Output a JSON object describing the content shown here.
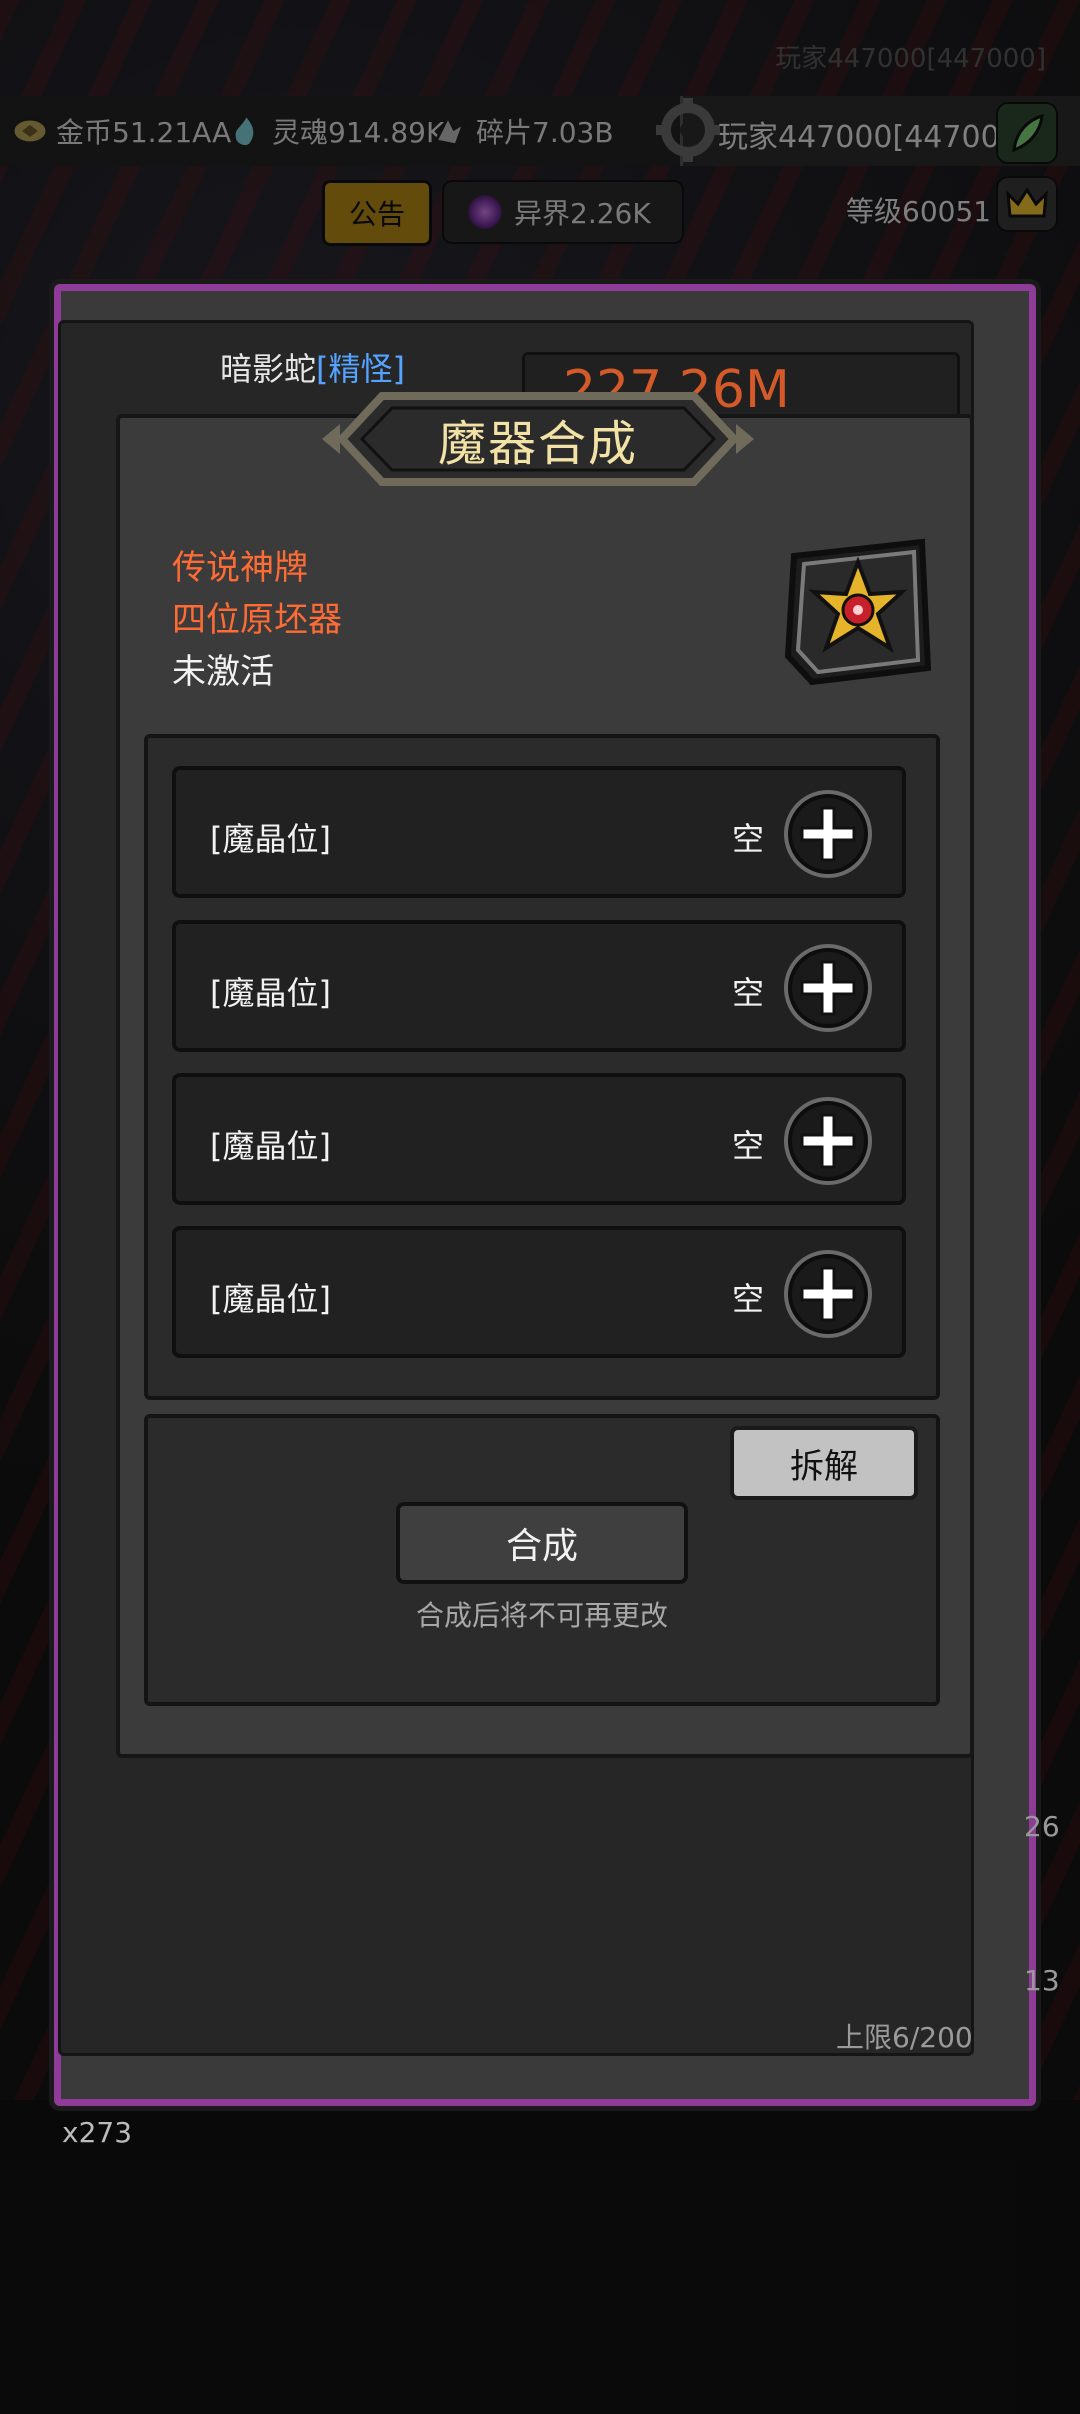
{
  "top_faint_text": "玩家447000[447000]",
  "resources": {
    "gold": "金币51.21AA",
    "soul": "灵魂914.89K",
    "fragment": "碎片7.03B"
  },
  "player": {
    "name": "玩家447000[447000]",
    "level": "等级60051"
  },
  "notice_button": "公告",
  "realm": "异界2.26K",
  "monster": {
    "name": "暗影蛇",
    "tag": "[精怪]"
  },
  "hp_value": "227.26M",
  "dialog": {
    "title": "魔器合成",
    "rarity": "传说神牌",
    "item_name": "四位原坯器",
    "status": "未激活",
    "slots": [
      {
        "label": "[魔晶位]",
        "state": "空"
      },
      {
        "label": "[魔晶位]",
        "state": "空"
      },
      {
        "label": "[魔晶位]",
        "state": "空"
      },
      {
        "label": "[魔晶位]",
        "state": "空"
      }
    ],
    "decompose_button": "拆解",
    "synth_button": "合成",
    "synth_hint": "合成后将不可再更改"
  },
  "storage_limit": "上限6/200",
  "inventory_count": "x273",
  "side_numbers": [
    "26",
    "13"
  ],
  "colors": {
    "rarity": "#ff6b35",
    "frame": "#8e3c98",
    "title": "#f3e2a6",
    "tag": "#55a3ff"
  }
}
